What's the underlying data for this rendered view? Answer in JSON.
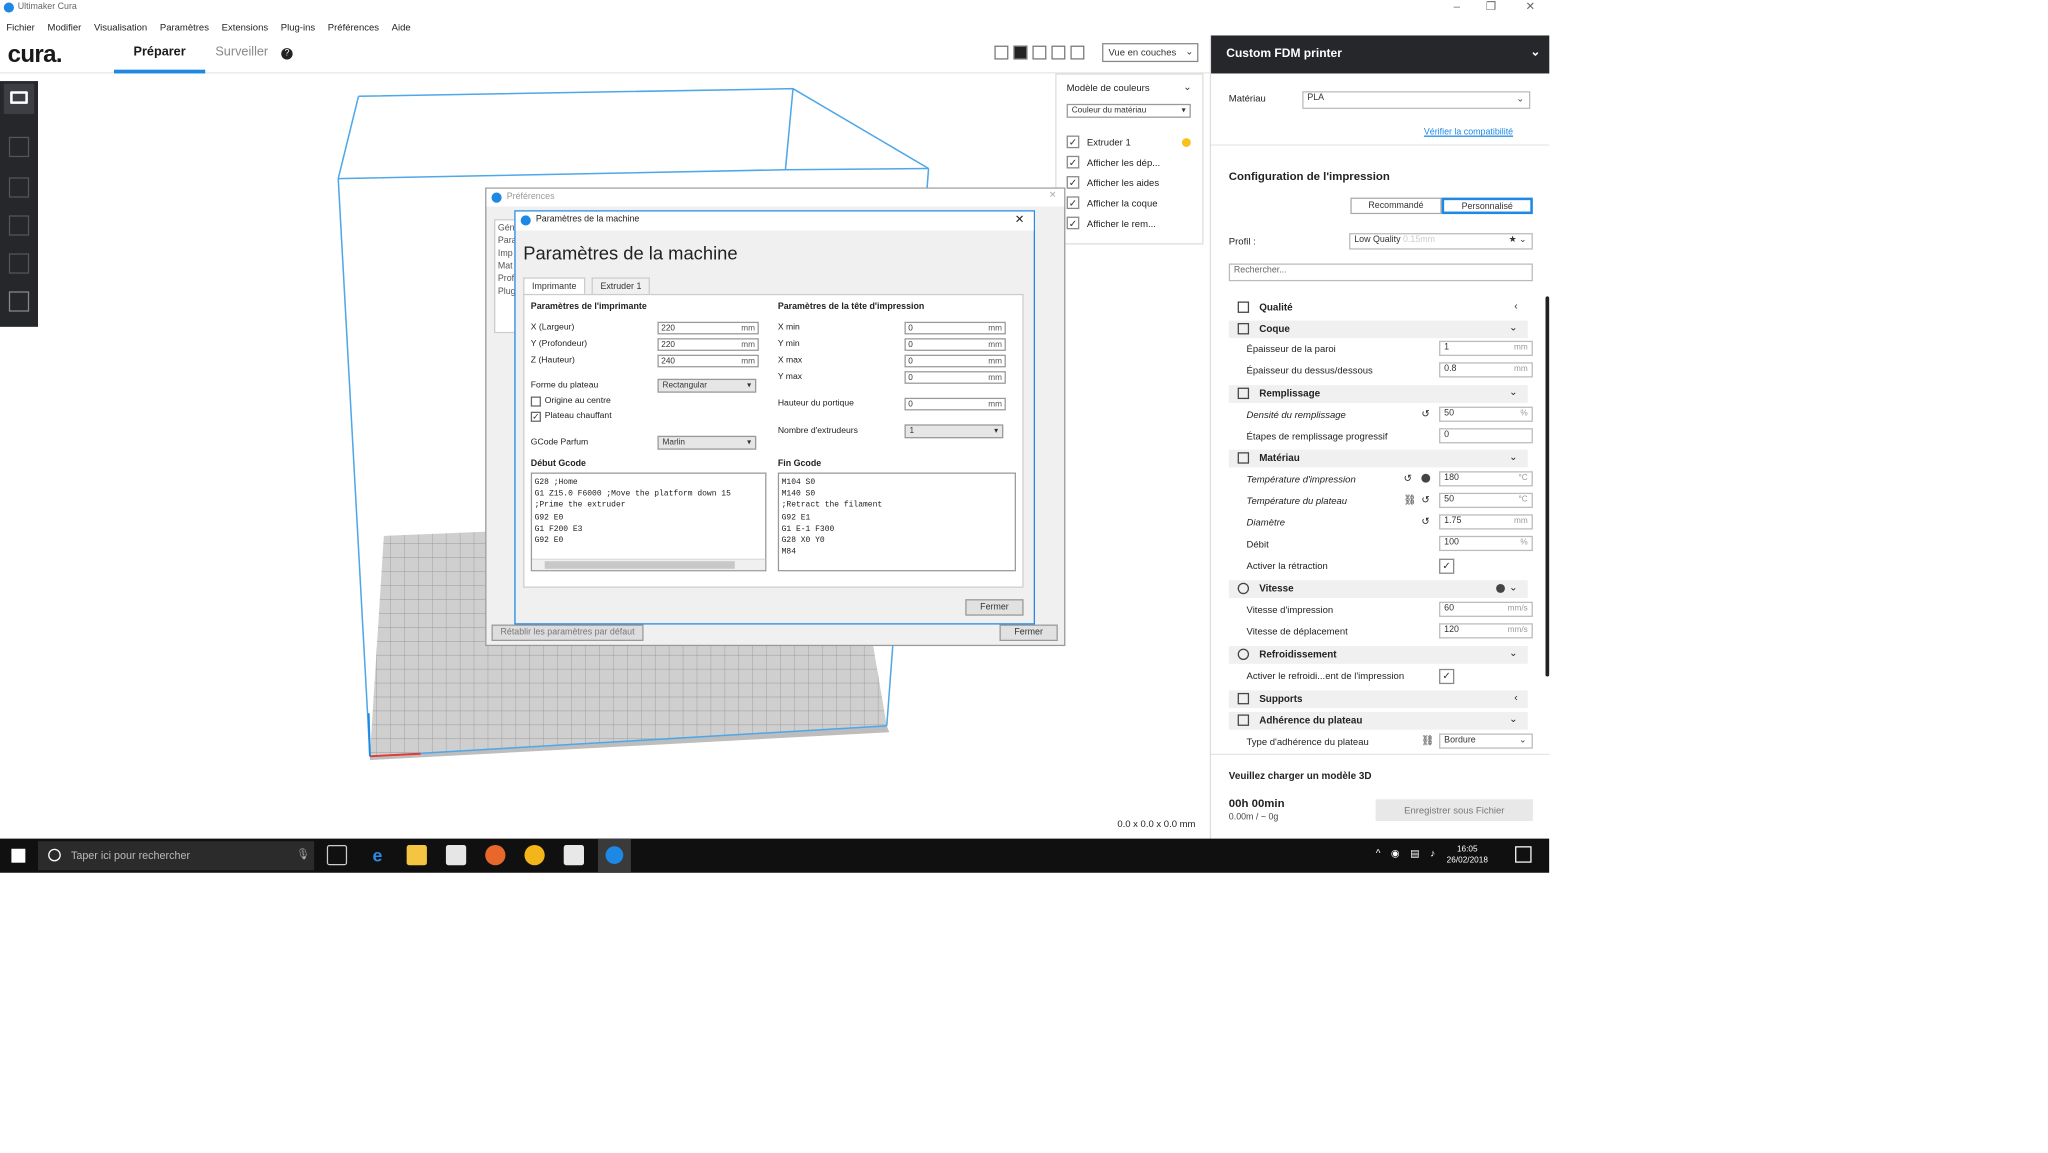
{
  "window": {
    "title": "Ultimaker Cura",
    "controls": [
      "–",
      "❐",
      "✕"
    ]
  },
  "menu": [
    "Fichier",
    "Modifier",
    "Visualisation",
    "Paramètres",
    "Extensions",
    "Plug-ins",
    "Préférences",
    "Aide"
  ],
  "header": {
    "logo": "cura.",
    "tab_prepare": "Préparer",
    "tab_monitor": "Surveiller",
    "view_mode": "Vue en couches"
  },
  "color_panel": {
    "scheme": "Modèle de couleurs",
    "mode": "Couleur du matériau",
    "items": [
      {
        "label": "Extruder 1",
        "checked": true
      },
      {
        "label": "Afficher les dép...",
        "checked": true
      },
      {
        "label": "Afficher les aides",
        "checked": true
      },
      {
        "label": "Afficher la coque",
        "checked": true
      },
      {
        "label": "Afficher le rem...",
        "checked": true
      }
    ],
    "extruder_color": "#f7c21c"
  },
  "dimensions": "0.0 x 0.0 x 0.0 mm",
  "preferences": {
    "title": "Préférences",
    "side": [
      "Gén",
      "Para",
      "Imp",
      "Mat",
      "Prof",
      "Plug"
    ],
    "reset": "Rétablir les paramètres par défaut",
    "close": "Fermer"
  },
  "machine": {
    "title": "Paramètres de la machine",
    "heading": "Paramètres de la machine",
    "tabs": [
      "Imprimante",
      "Extruder 1"
    ],
    "printer_settings": "Paramètres de l'imprimante",
    "x_label": "X (Largeur)",
    "x_val": "220",
    "y_label": "Y (Profondeur)",
    "y_val": "220",
    "z_label": "Z (Hauteur)",
    "z_val": "240",
    "unit": "mm",
    "bed_shape_label": "Forme du plateau",
    "bed_shape": "Rectangular",
    "origin_center": "Origine au centre",
    "heated_bed": "Plateau chauffant",
    "flavor_label": "GCode Parfum",
    "flavor": "Marlin",
    "head_settings": "Paramètres de la tête d'impression",
    "xmin_label": "X min",
    "xmin": "0",
    "ymin_label": "Y min",
    "ymin": "0",
    "xmax_label": "X max",
    "xmax": "0",
    "ymax_label": "Y max",
    "ymax": "0",
    "gantry_label": "Hauteur du portique",
    "gantry": "0",
    "extruders_label": "Nombre d'extrudeurs",
    "extruders": "1",
    "start_label": "Début Gcode",
    "start_gcode": "G28 ;Home\nG1 Z15.0 F6000 ;Move the platform down 15\n;Prime the extruder\nG92 E0\nG1 F200 E3\nG92 E0",
    "end_label": "Fin Gcode",
    "end_gcode": "M104 S0\nM140 S0\n;Retract the filament\nG92 E1\nG1 E-1 F300\nG28 X0 Y0\nM84",
    "close": "Fermer"
  },
  "right_panel": {
    "printer": "Custom FDM printer",
    "material_label": "Matériau",
    "material": "PLA",
    "compat": "Vérifier la compatibilité",
    "config_title": "Configuration de l'impression",
    "mode_recommended": "Recommandé",
    "mode_custom": "Personnalisé",
    "profile_label": "Profil :",
    "profile": "Low Quality",
    "profile_sub": "0.15mm",
    "search_placeholder": "Rechercher...",
    "sections": {
      "quality": "Qualité",
      "shell": "Coque",
      "infill": "Remplissage",
      "material": "Matériau",
      "speed": "Vitesse",
      "cooling": "Refroidissement",
      "support": "Supports",
      "adhesion": "Adhérence du plateau"
    },
    "settings": {
      "wall": {
        "label": "Épaisseur de la paroi",
        "value": "1",
        "unit": "mm"
      },
      "topbottom": {
        "label": "Épaisseur du dessus/dessous",
        "value": "0.8",
        "unit": "mm"
      },
      "infill_density": {
        "label": "Densité du remplissage",
        "value": "50",
        "unit": "%"
      },
      "infill_steps": {
        "label": "Étapes de remplissage progressif",
        "value": "0"
      },
      "print_temp": {
        "label": "Température d'impression",
        "value": "180",
        "unit": "°C"
      },
      "bed_temp": {
        "label": "Température du plateau",
        "value": "50",
        "unit": "°C"
      },
      "diameter": {
        "label": "Diamètre",
        "value": "1.75",
        "unit": "mm"
      },
      "flow": {
        "label": "Débit",
        "value": "100",
        "unit": "%"
      },
      "retraction": {
        "label": "Activer la rétraction"
      },
      "print_speed": {
        "label": "Vitesse d'impression",
        "value": "60",
        "unit": "mm/s"
      },
      "travel_speed": {
        "label": "Vitesse de déplacement",
        "value": "120",
        "unit": "mm/s"
      },
      "cooling_enable": {
        "label": "Activer le refroidi...ent de l'impression"
      },
      "adhesion_type": {
        "label": "Type d'adhérence du plateau",
        "value": "Bordure"
      }
    },
    "load_model": "Veuillez charger un modèle 3D",
    "time": "00h 00min",
    "usage": "0.00m / ~ 0g",
    "save": "Enregistrer sous Fichier"
  },
  "taskbar": {
    "search": "Taper ici pour rechercher",
    "time": "16:05",
    "date": "26/02/2018"
  }
}
